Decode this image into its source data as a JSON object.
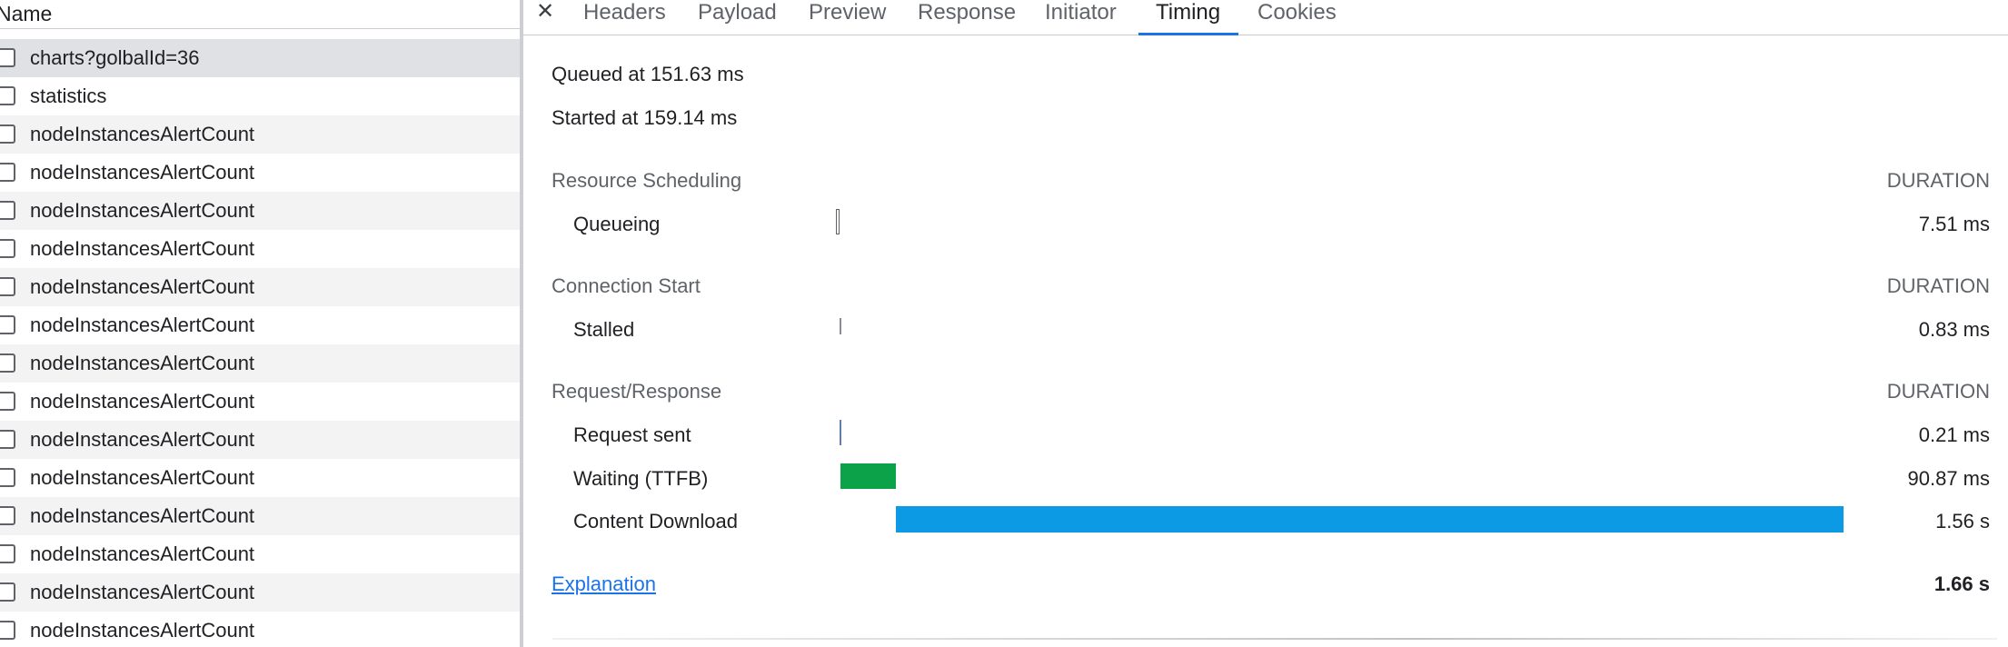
{
  "request_list": {
    "header": "Name",
    "rows": [
      {
        "label": "charts?golbalId=36",
        "selected": true
      },
      {
        "label": "statistics"
      },
      {
        "label": "nodeInstancesAlertCount"
      },
      {
        "label": "nodeInstancesAlertCount"
      },
      {
        "label": "nodeInstancesAlertCount"
      },
      {
        "label": "nodeInstancesAlertCount"
      },
      {
        "label": "nodeInstancesAlertCount"
      },
      {
        "label": "nodeInstancesAlertCount"
      },
      {
        "label": "nodeInstancesAlertCount"
      },
      {
        "label": "nodeInstancesAlertCount"
      },
      {
        "label": "nodeInstancesAlertCount"
      },
      {
        "label": "nodeInstancesAlertCount"
      },
      {
        "label": "nodeInstancesAlertCount"
      },
      {
        "label": "nodeInstancesAlertCount"
      },
      {
        "label": "nodeInstancesAlertCount"
      },
      {
        "label": "nodeInstancesAlertCount"
      }
    ]
  },
  "tabs": {
    "close_icon": "close-icon",
    "items": [
      "Headers",
      "Payload",
      "Preview",
      "Response",
      "Initiator",
      "Timing",
      "Cookies"
    ],
    "active": "Timing"
  },
  "timing": {
    "queued_at": "Queued at 151.63 ms",
    "started_at": "Started at 159.14 ms",
    "duration_header": "DURATION",
    "sections": [
      {
        "title": "Resource Scheduling",
        "phases": [
          {
            "name": "Queueing",
            "duration": "7.51 ms"
          }
        ]
      },
      {
        "title": "Connection Start",
        "phases": [
          {
            "name": "Stalled",
            "duration": "0.83 ms"
          }
        ]
      },
      {
        "title": "Request/Response",
        "phases": [
          {
            "name": "Request sent",
            "duration": "0.21 ms"
          },
          {
            "name": "Waiting (TTFB)",
            "duration": "90.87 ms",
            "color": "#0ca24a"
          },
          {
            "name": "Content Download",
            "duration": "1.56 s",
            "color": "#0b9ae3"
          }
        ]
      }
    ],
    "explanation_link": "Explanation",
    "total": "1.66 s"
  }
}
